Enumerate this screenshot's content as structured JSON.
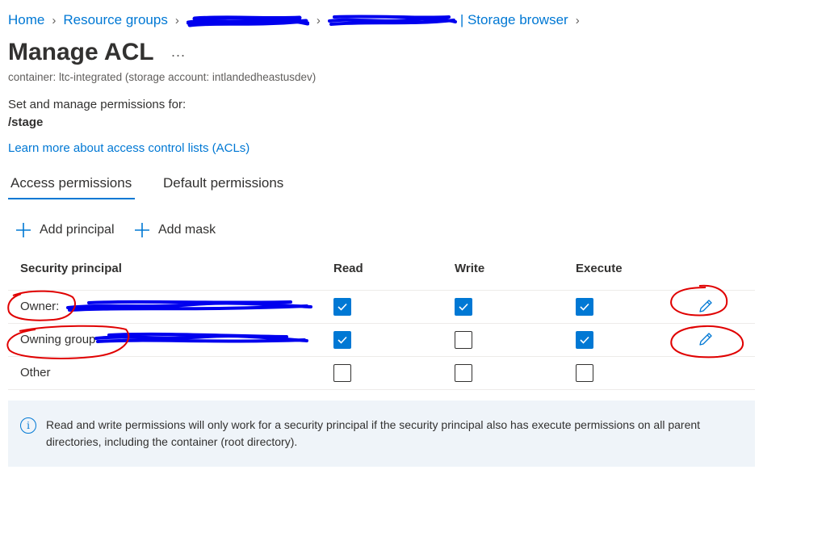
{
  "breadcrumb": {
    "home": "Home",
    "resource_groups": "Resource groups",
    "storage_browser": "| Storage browser"
  },
  "page": {
    "title": "Manage ACL",
    "more": "...",
    "subtitle": "container: ltc-integrated (storage account: intlandedheastusdev)",
    "permissions_label": "Set and manage permissions for:",
    "path": "/stage",
    "learn_more": "Learn more about access control lists (ACLs)"
  },
  "tabs": [
    {
      "label": "Access permissions",
      "active": true
    },
    {
      "label": "Default permissions",
      "active": false
    }
  ],
  "commands": {
    "add_principal": "Add principal",
    "add_mask": "Add mask"
  },
  "table": {
    "headers": {
      "principal": "Security principal",
      "read": "Read",
      "write": "Write",
      "execute": "Execute"
    },
    "rows": [
      {
        "name": "Owner:",
        "read": true,
        "write": true,
        "execute": true,
        "editable": true
      },
      {
        "name": "Owning group:",
        "read": true,
        "write": false,
        "execute": true,
        "editable": true
      },
      {
        "name": "Other",
        "read": false,
        "write": false,
        "execute": false,
        "editable": false
      }
    ]
  },
  "info": {
    "icon": "info-icon",
    "text": "Read and write permissions will only work for a security principal if the security principal also has execute permissions on all parent directories, including the container (root directory)."
  },
  "colors": {
    "accent": "#0078d4",
    "redaction": "#0000ee",
    "annotation": "#e00000",
    "info_bg": "#eff4f9"
  }
}
